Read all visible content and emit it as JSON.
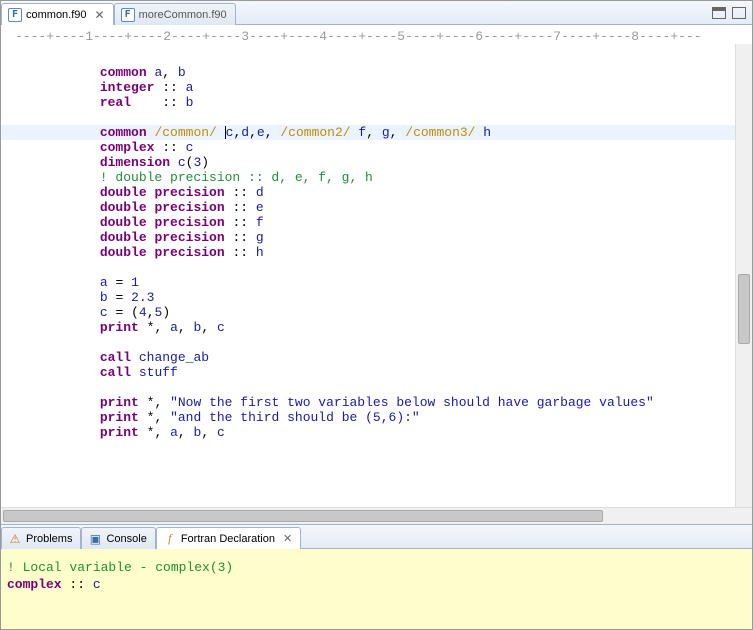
{
  "tabs": [
    {
      "label": "common.f90",
      "active": true,
      "icon": "F"
    },
    {
      "label": "moreCommon.f90",
      "active": false,
      "icon": "F"
    }
  ],
  "ruler": "----+----1----+----2----+----3----+----4----+----5----+----6----+----7----+----8----+---",
  "code": {
    "indent": "      ",
    "lines": [
      {
        "t": "blank"
      },
      {
        "t": "code",
        "spans": [
          [
            "kw",
            "common"
          ],
          [
            "",
            ", "
          ],
          [
            "ident",
            "a"
          ],
          [
            "",
            ", "
          ],
          [
            "ident",
            "b"
          ]
        ],
        "fix": "common a, b"
      },
      {
        "t": "code",
        "fix": "integer :: a"
      },
      {
        "t": "code",
        "fix": "real    :: b"
      },
      {
        "t": "blank"
      },
      {
        "t": "code",
        "hl": true,
        "fix": "common /common/ c,d,e, /common2/ f, g, /common3/ h"
      },
      {
        "t": "code",
        "fix": "complex :: c"
      },
      {
        "t": "code",
        "fix": "dimension c(3)"
      },
      {
        "t": "comment",
        "text": "! double precision :: d, e, f, g, h"
      },
      {
        "t": "code",
        "fix": "double precision :: d"
      },
      {
        "t": "code",
        "fix": "double precision :: e"
      },
      {
        "t": "code",
        "fix": "double precision :: f"
      },
      {
        "t": "code",
        "fix": "double precision :: g"
      },
      {
        "t": "code",
        "fix": "double precision :: h"
      },
      {
        "t": "blank"
      },
      {
        "t": "code",
        "fix": "a = 1"
      },
      {
        "t": "code",
        "fix": "b = 2.3"
      },
      {
        "t": "code",
        "fix": "c = (4,5)"
      },
      {
        "t": "code",
        "fix": "print *, a, b, c"
      },
      {
        "t": "blank"
      },
      {
        "t": "code",
        "fix": "call change_ab"
      },
      {
        "t": "code",
        "fix": "call stuff"
      },
      {
        "t": "blank"
      },
      {
        "t": "code",
        "fix": "print *, \"Now the first two variables below should have garbage values\""
      },
      {
        "t": "code",
        "fix": "print *, \"and the third should be (5,6):\""
      },
      {
        "t": "code",
        "fix": "print *, a, b, c"
      }
    ]
  },
  "bottomTabs": [
    {
      "label": "Problems",
      "icon": "⚠",
      "active": false
    },
    {
      "label": "Console",
      "icon": "▣",
      "active": false
    },
    {
      "label": "Fortran Declaration",
      "icon": "f",
      "active": true
    }
  ],
  "declaration": {
    "line1": "! Local variable - complex(3)",
    "line2_kw": "complex",
    "line2_sep": " :: ",
    "line2_id": "c"
  },
  "colors": {
    "keyword": "#7a007a",
    "identifier": "#1a1aa6",
    "slash": "#c28e00",
    "comment": "#1f8f3b"
  }
}
